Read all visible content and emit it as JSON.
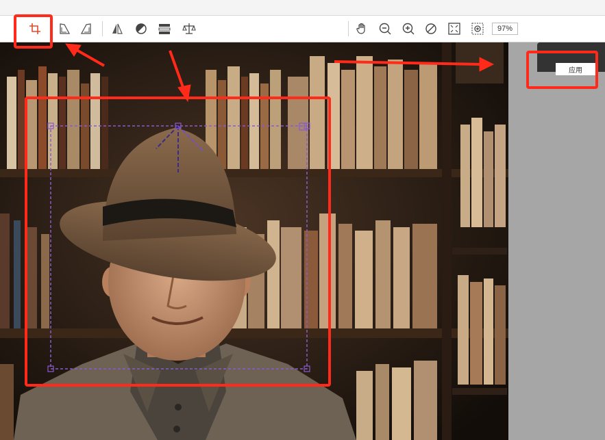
{
  "toolbar": {
    "zoom_level": "97%",
    "tools_left": [
      {
        "name": "crop-icon",
        "active": true
      },
      {
        "name": "rotate-left-icon"
      },
      {
        "name": "rotate-right-icon"
      },
      {
        "name": "flip-icon"
      },
      {
        "name": "contrast-icon"
      },
      {
        "name": "adjust-icon"
      },
      {
        "name": "balance-icon"
      }
    ],
    "tools_right": [
      {
        "name": "hand-icon"
      },
      {
        "name": "zoom-out-icon"
      },
      {
        "name": "zoom-in-icon"
      },
      {
        "name": "reset-zoom-icon"
      },
      {
        "name": "fit-screen-icon"
      },
      {
        "name": "actual-size-icon"
      }
    ]
  },
  "panel": {
    "apply_label": "应用"
  },
  "colors": {
    "accent": "#ff2a1a",
    "crop_guide": "#7a4fc0",
    "active_tool": "#e8462a",
    "panel_bg": "#a6a6a6"
  }
}
